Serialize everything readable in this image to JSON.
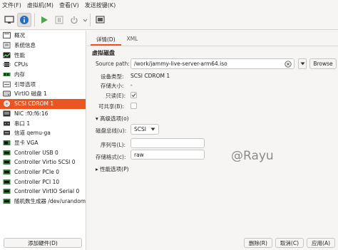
{
  "menu": [
    "文件(F)",
    "虚拟机(M)",
    "查看(V)",
    "发送按键(K)"
  ],
  "toolbar": {
    "buttons": [
      "display-icon",
      "info-icon",
      "play-icon",
      "pause-icon",
      "power-icon",
      "screenshot-icon"
    ]
  },
  "sidebar": {
    "items": [
      {
        "label": "概况",
        "icon": "overview-icon"
      },
      {
        "label": "系统信息",
        "icon": "sysinfo-icon"
      },
      {
        "label": "性能",
        "icon": "performance-icon"
      },
      {
        "label": "CPUs",
        "icon": "cpu-icon"
      },
      {
        "label": "内存",
        "icon": "memory-icon"
      },
      {
        "label": "引导选项",
        "icon": "boot-icon"
      },
      {
        "label": "VirtIO 磁盘 1",
        "icon": "disk-icon"
      },
      {
        "label": "SCSI CDROM 1",
        "icon": "cdrom-icon",
        "selected": true
      },
      {
        "label": "NIC :f0:f6:16",
        "icon": "nic-icon"
      },
      {
        "label": "串口 1",
        "icon": "serial-icon"
      },
      {
        "label": "信道 qemu-ga",
        "icon": "channel-icon"
      },
      {
        "label": "显卡 VGA",
        "icon": "video-icon"
      },
      {
        "label": "Controller USB 0",
        "icon": "controller-icon"
      },
      {
        "label": "Controller Virtio SCSI 0",
        "icon": "controller-icon"
      },
      {
        "label": "Controller PCIe 0",
        "icon": "controller-icon"
      },
      {
        "label": "Controller PCI 10",
        "icon": "controller-icon"
      },
      {
        "label": "Controller VirtIO Serial 0",
        "icon": "controller-icon"
      },
      {
        "label": "随机数生成器 /dev/urandom",
        "icon": "rng-icon"
      }
    ],
    "add_hardware": "添加硬件(D)"
  },
  "tabs": [
    "详情(D)",
    "XML"
  ],
  "disk": {
    "title": "虚拟磁盘",
    "source_label": "Source path:",
    "source_value": "/work/jammy-live-server-arm64.iso",
    "browse": "Browse",
    "device_type_label": "设备类型:",
    "device_type_value": "SCSI CDROM 1",
    "size_label": "存储大小:",
    "size_value": "-",
    "readonly_label": "只读(E):",
    "readonly_checked": true,
    "shareable_label": "可共享(B):",
    "shareable_checked": false
  },
  "advanced": {
    "title": "高级选项(o)",
    "bus_label": "磁盘总线(u):",
    "bus_value": "SCSI",
    "serial_label": "序列号(L):",
    "serial_value": "",
    "format_label": "存储格式(c):",
    "format_value": "raw",
    "perf_title": "性能选项(P)"
  },
  "watermark": "@Rayu",
  "buttons": {
    "remove": "删除(R)",
    "cancel": "取消(C)",
    "apply": "应用(A)"
  }
}
